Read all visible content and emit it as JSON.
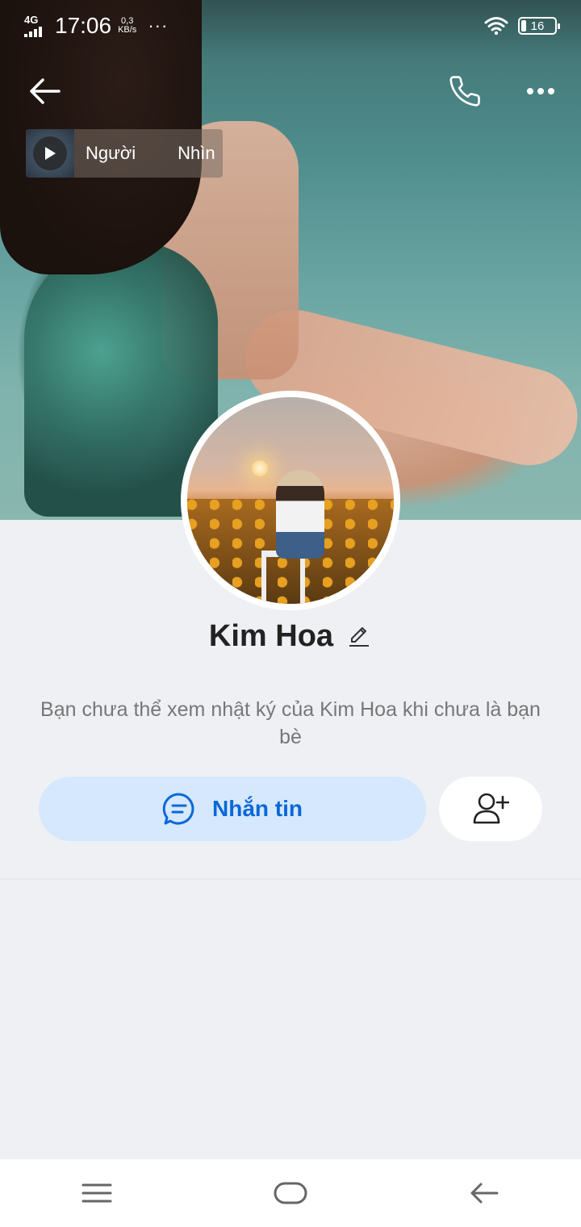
{
  "status_bar": {
    "network": "4G",
    "time": "17:06",
    "speed_value": "0,3",
    "speed_unit": "KB/s",
    "more": "···",
    "battery": "16"
  },
  "header": {
    "back_icon": "arrow-left-icon",
    "call_icon": "phone-icon",
    "more_icon": "more-horizontal-icon"
  },
  "music": {
    "text_1": "Người",
    "text_2": "Nhìn"
  },
  "profile": {
    "name": "Kim Hoa",
    "notice": "Bạn chưa thể xem nhật ký của Kim Hoa khi chưa là bạn bè"
  },
  "actions": {
    "message_label": "Nhắn tin",
    "message_color": "#0a68d8",
    "message_bg": "#d5e8fd"
  },
  "navbar": {
    "items": [
      "menu-icon",
      "home-icon",
      "back-icon"
    ]
  }
}
